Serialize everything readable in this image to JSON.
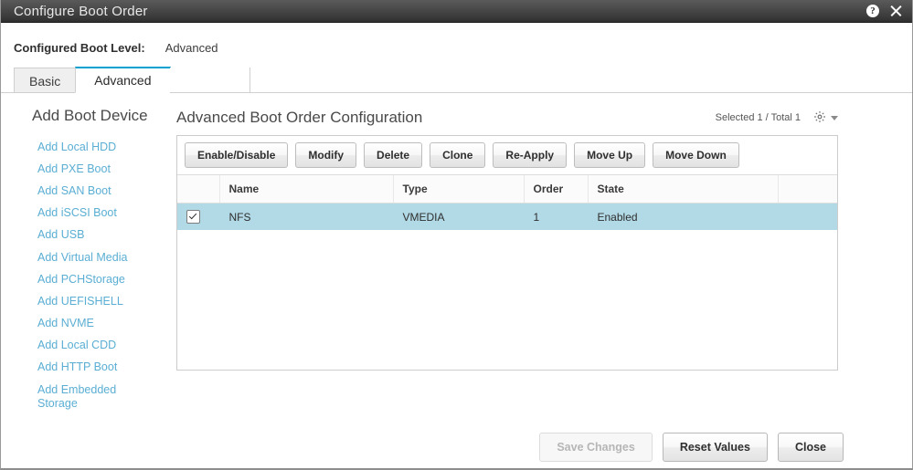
{
  "window": {
    "title": "Configure Boot Order",
    "help_icon": "help-circle-icon",
    "close_icon": "close-icon"
  },
  "boot_level": {
    "label": "Configured Boot Level:",
    "value": "Advanced"
  },
  "tabs": [
    {
      "label": "Basic",
      "active": false
    },
    {
      "label": "Advanced",
      "active": true
    }
  ],
  "sidebar": {
    "title": "Add Boot Device",
    "items": [
      {
        "label": "Add Local HDD"
      },
      {
        "label": "Add PXE Boot"
      },
      {
        "label": "Add SAN Boot"
      },
      {
        "label": "Add iSCSI Boot"
      },
      {
        "label": "Add USB"
      },
      {
        "label": "Add Virtual Media"
      },
      {
        "label": "Add PCHStorage"
      },
      {
        "label": "Add UEFISHELL"
      },
      {
        "label": "Add NVME"
      },
      {
        "label": "Add Local CDD"
      },
      {
        "label": "Add HTTP Boot"
      },
      {
        "label": "Add Embedded Storage"
      }
    ]
  },
  "main": {
    "title": "Advanced Boot Order Configuration",
    "counts": "Selected 1 / Total 1",
    "gear_icon": "gear-icon",
    "caret_icon": "chevron-down-icon",
    "toolbar": [
      {
        "label": "Enable/Disable"
      },
      {
        "label": "Modify"
      },
      {
        "label": "Delete"
      },
      {
        "label": "Clone"
      },
      {
        "label": "Re-Apply"
      },
      {
        "label": "Move Up"
      },
      {
        "label": "Move Down"
      }
    ],
    "table": {
      "columns": [
        "",
        "Name",
        "Type",
        "Order",
        "State",
        ""
      ],
      "rows": [
        {
          "selected": true,
          "checked": true,
          "name": "NFS",
          "type": "VMEDIA",
          "order": "1",
          "state": "Enabled"
        }
      ]
    }
  },
  "footer": {
    "buttons": [
      {
        "label": "Save Changes",
        "disabled": true
      },
      {
        "label": "Reset Values",
        "disabled": false
      },
      {
        "label": "Close",
        "disabled": false
      }
    ]
  },
  "colors": {
    "accent": "#00a0d1",
    "link": "#5aaed3",
    "row_selected": "#b1d9e6",
    "titlebar_top": "#5a5a5a",
    "titlebar_bottom": "#303030"
  }
}
